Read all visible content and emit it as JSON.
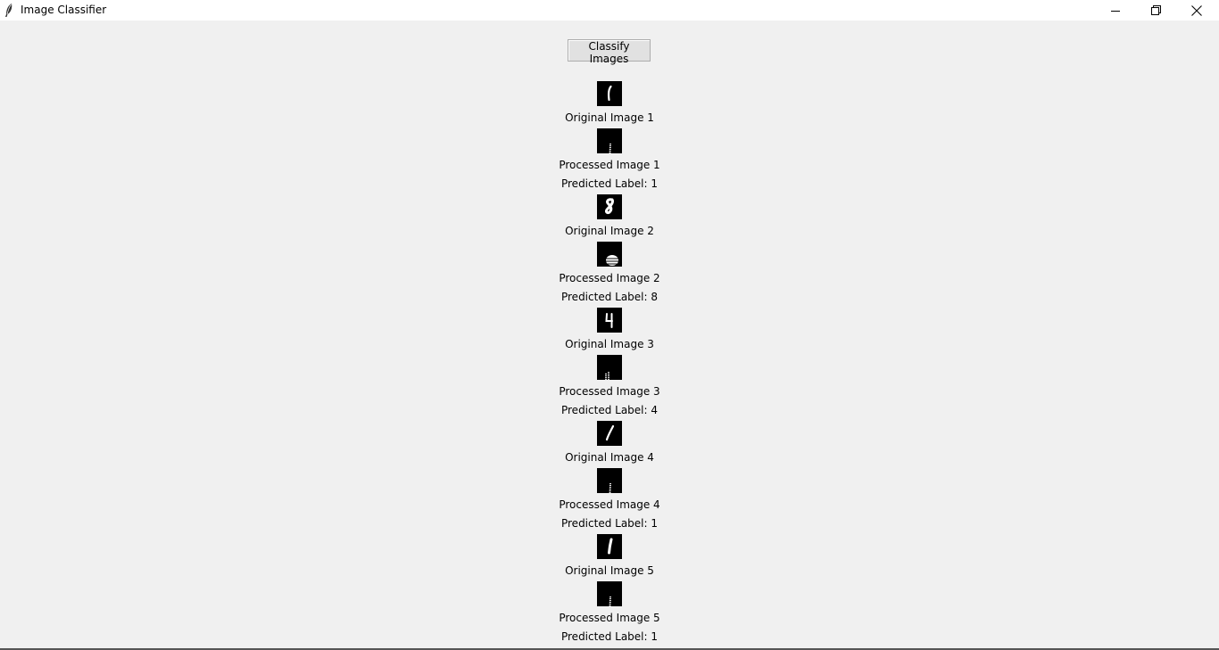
{
  "window": {
    "title": "Image Classifier",
    "icon": "feather-icon"
  },
  "toolbar": {
    "classify_label": "Classify Images"
  },
  "results": [
    {
      "original_label": "Original Image 1",
      "processed_label": "Processed Image 1",
      "prediction": "Predicted Label: 1",
      "digit": "1"
    },
    {
      "original_label": "Original Image 2",
      "processed_label": "Processed Image 2",
      "prediction": "Predicted Label: 8",
      "digit": "8"
    },
    {
      "original_label": "Original Image 3",
      "processed_label": "Processed Image 3",
      "prediction": "Predicted Label: 4",
      "digit": "4"
    },
    {
      "original_label": "Original Image 4",
      "processed_label": "Processed Image 4",
      "prediction": "Predicted Label: 1",
      "digit": "1"
    },
    {
      "original_label": "Original Image 5",
      "processed_label": "Processed Image 5",
      "prediction": "Predicted Label: 1",
      "digit": "1"
    }
  ]
}
